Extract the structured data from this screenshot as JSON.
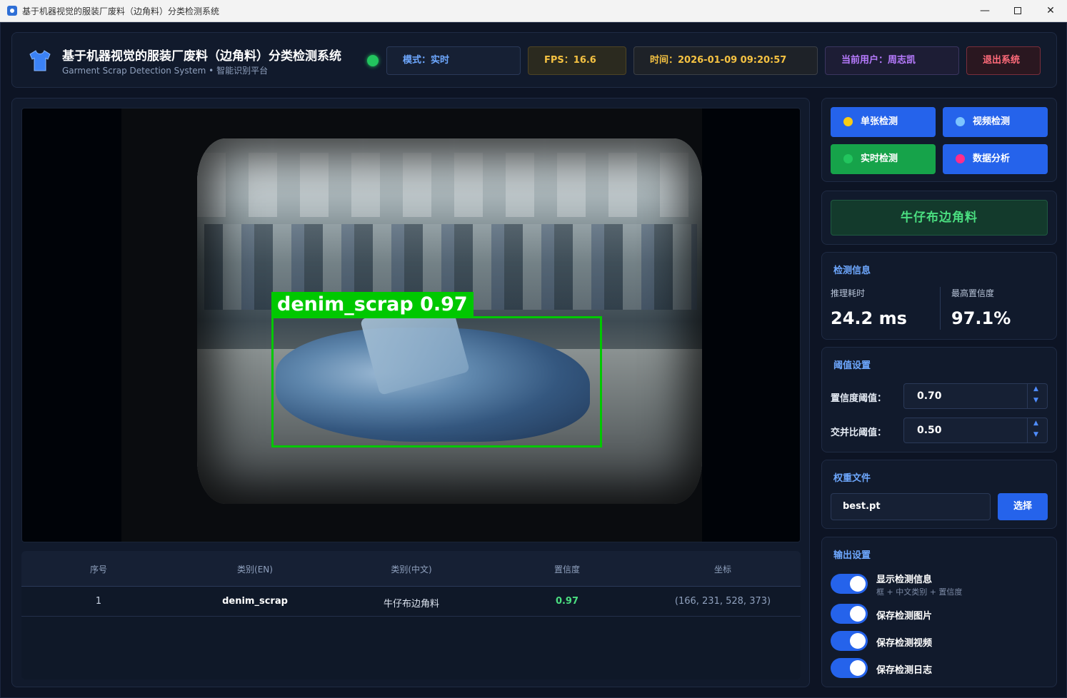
{
  "window": {
    "title": "基于机器视觉的服装厂废料（边角料）分类检测系统",
    "minimize": "—",
    "close": "✕"
  },
  "header": {
    "title": "基于机器视觉的服装厂废料（边角料）分类检测系统",
    "subtitle": "Garment Scrap Detection System • 智能识别平台",
    "mode": "模式：实时",
    "fps": "FPS：16.6",
    "time": "时间：2026-01-09 09:20:57",
    "user": "当前用户：周志凯",
    "logout": "退出系统"
  },
  "detection_overlay": {
    "label": "denim_scrap",
    "score": "0.97"
  },
  "results_table": {
    "columns": [
      "序号",
      "类别(EN)",
      "类别(中文)",
      "置信度",
      "坐标"
    ],
    "rows": [
      [
        "1",
        "denim_scrap",
        "牛仔布边角料",
        "0.97",
        "(166, 231, 528, 373)"
      ]
    ]
  },
  "modes": {
    "single": "单张检测",
    "video": "视频检测",
    "realtime": "实时检测",
    "analysis": "数据分析"
  },
  "current_class": "牛仔布边角料",
  "detect_info": {
    "title": "检测信息",
    "infer_label": "推理耗时",
    "infer_value": "24.2 ms",
    "conf_label": "最高置信度",
    "conf_value": "97.1%"
  },
  "thresholds": {
    "title": "阈值设置",
    "conf_label": "置信度阈值：",
    "conf_value": "0.70",
    "iou_label": "交并比阈值：",
    "iou_value": "0.50"
  },
  "weights": {
    "title": "权重文件",
    "file": "best.pt",
    "select": "选择"
  },
  "output": {
    "title": "输出设置",
    "items": [
      {
        "label": "显示检测信息",
        "sub": "框 + 中文类别 + 置信度",
        "on": true
      },
      {
        "label": "保存检测图片",
        "on": true
      },
      {
        "label": "保存检测视频",
        "on": true
      },
      {
        "label": "保存检测日志",
        "on": true
      }
    ]
  },
  "colors": {
    "accent": "#2563eb",
    "success": "#16a34a",
    "bbox": "#00c800",
    "fps": "#f5c242",
    "user": "#b77bff",
    "danger": "#ff6b7a"
  }
}
